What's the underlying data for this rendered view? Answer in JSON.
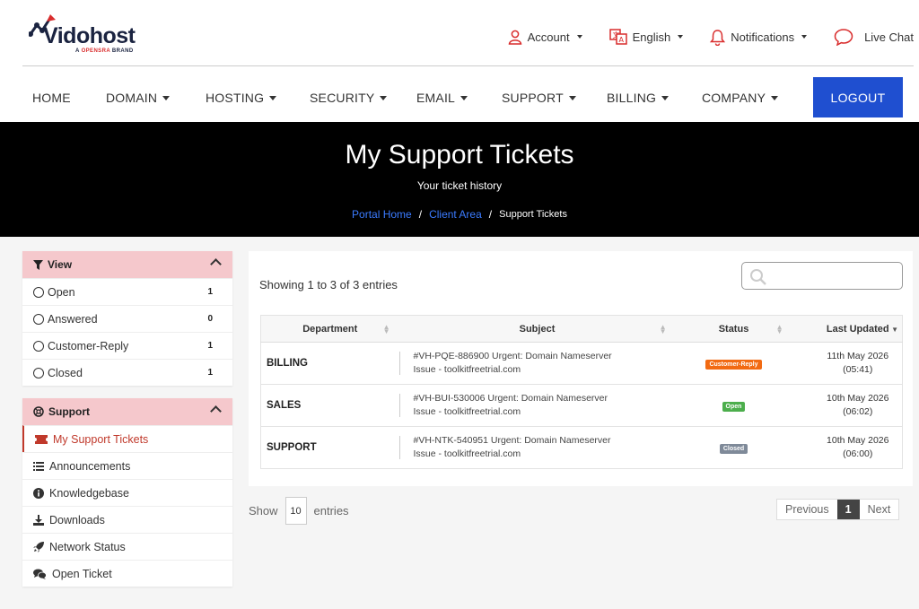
{
  "brand": {
    "name": "Vidohost",
    "tagline_prefix": "A ",
    "tagline_brand": "OPENSRA",
    "tagline_suffix": " BRAND"
  },
  "toplinks": {
    "account": "Account",
    "language": "English",
    "notifications": "Notifications",
    "livechat": "Live Chat"
  },
  "nav": {
    "home": "HOME",
    "domain": "DOMAIN",
    "hosting": "HOSTING",
    "security": "SECURITY",
    "email": "EMAIL",
    "support": "SUPPORT",
    "billing": "BILLING",
    "company": "COMPANY",
    "logout": "LOGOUT"
  },
  "hero": {
    "title": "My Support Tickets",
    "subtitle": "Your ticket history",
    "breadcrumb": {
      "home": "Portal Home",
      "client": "Client Area",
      "current": "Support Tickets",
      "sep": "/"
    }
  },
  "sidebar": {
    "view": {
      "title": "View",
      "items": [
        {
          "label": "Open",
          "count": "1"
        },
        {
          "label": "Answered",
          "count": "0"
        },
        {
          "label": "Customer-Reply",
          "count": "1"
        },
        {
          "label": "Closed",
          "count": "1"
        }
      ]
    },
    "support": {
      "title": "Support",
      "items": [
        {
          "label": "My Support Tickets"
        },
        {
          "label": "Announcements"
        },
        {
          "label": "Knowledgebase"
        },
        {
          "label": "Downloads"
        },
        {
          "label": "Network Status"
        },
        {
          "label": "Open Ticket"
        }
      ]
    }
  },
  "tickets": {
    "showing": "Showing 1 to 3 of 3 entries",
    "columns": [
      "Department",
      "Subject",
      "Status",
      "Last Updated"
    ],
    "rows": [
      {
        "department": "BILLING",
        "subject_line1": "#VH-PQE-886900 Urgent: Domain Nameserver",
        "subject_line2": "Issue - toolkitfreetrial.com",
        "status": "Customer-Reply",
        "status_color": "#f26a12",
        "date": "11th May 2026",
        "time": "(05:41)"
      },
      {
        "department": "SALES",
        "subject_line1": "#VH-BUI-530006 Urgent: Domain Nameserver",
        "subject_line2": "Issue - toolkitfreetrial.com",
        "status": "Open",
        "status_color": "#4cae4c",
        "date": "10th May 2026",
        "time": "(06:02)"
      },
      {
        "department": "SUPPORT",
        "subject_line1": "#VH-NTK-540951 Urgent: Domain Nameserver",
        "subject_line2": "Issue - toolkitfreetrial.com",
        "status": "Closed",
        "status_color": "#7f8a99",
        "date": "10th May 2026",
        "time": "(06:00)"
      }
    ]
  },
  "footer": {
    "show": "Show",
    "entries_value": "10",
    "entries": "entries",
    "previous": "Previous",
    "page": "1",
    "next": "Next"
  },
  "colors": {
    "accent": "#1f4fd0",
    "panel_header": "#f5c8cc",
    "active_red": "#c0392b",
    "link_blue": "#3b7bff"
  }
}
